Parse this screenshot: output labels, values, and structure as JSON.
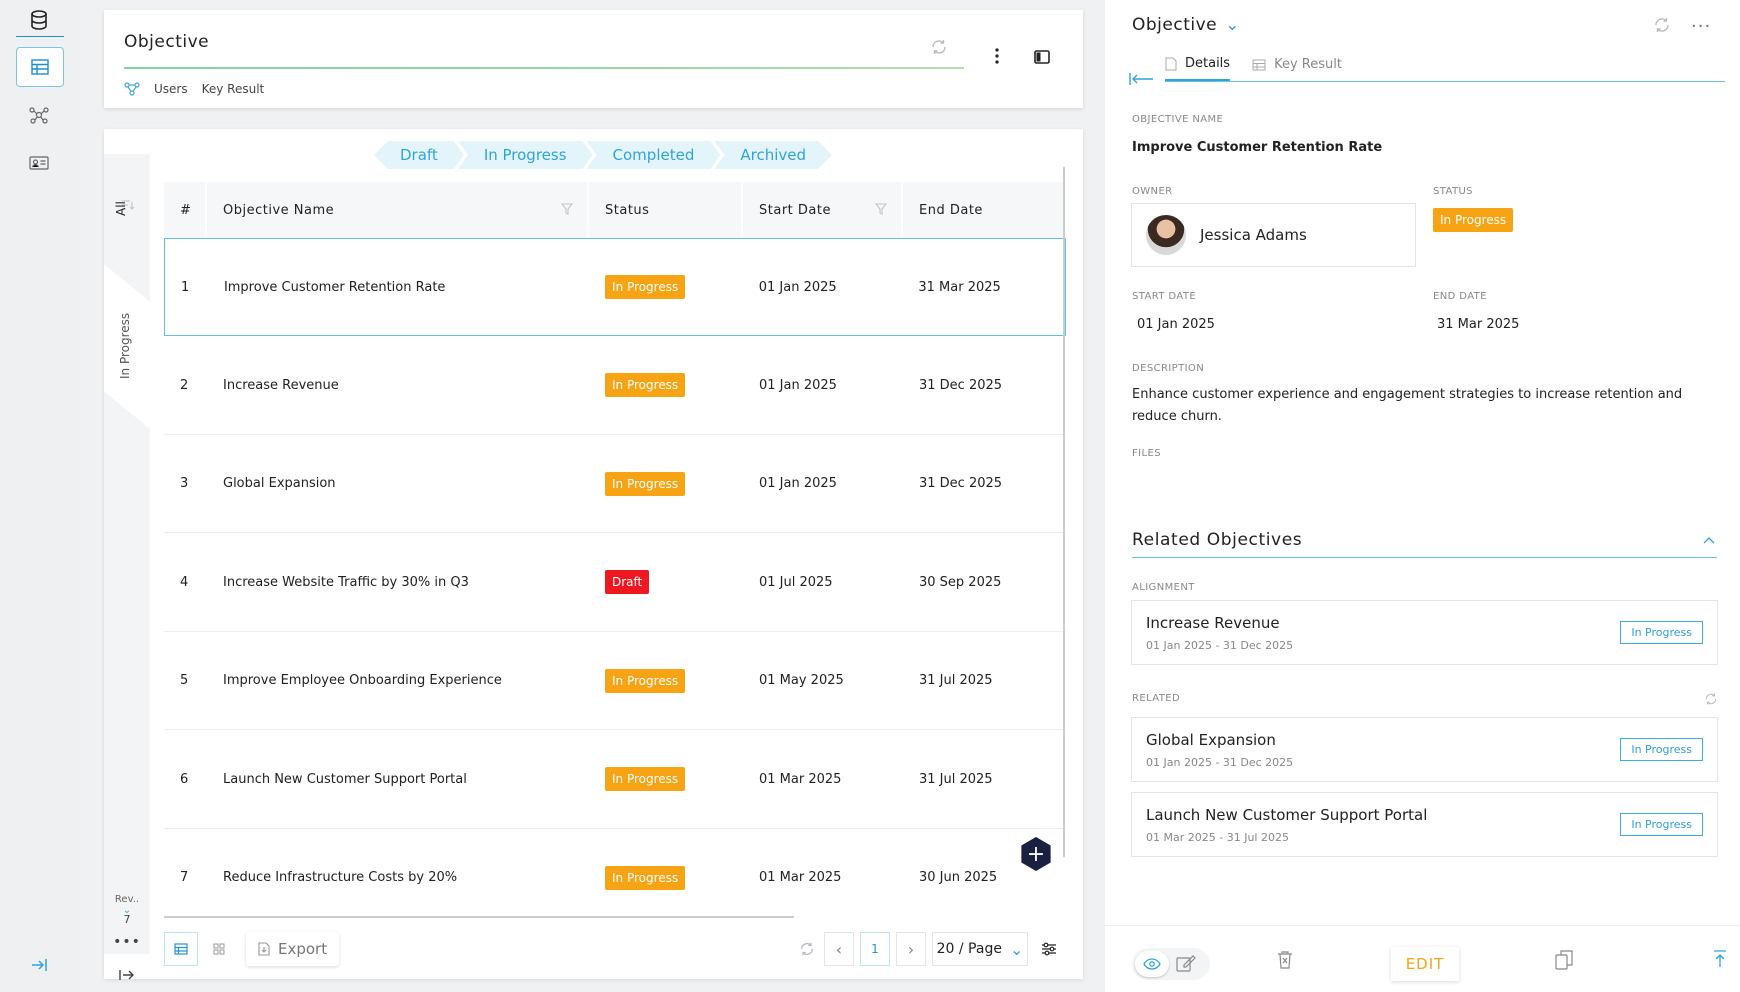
{
  "header": {
    "title": "Objective",
    "links": [
      "Users",
      "Key Result"
    ]
  },
  "status_chips": [
    "Draft",
    "In Progress",
    "Completed",
    "Archived"
  ],
  "side_tabs": {
    "all": "All",
    "in_progress": "In Progress",
    "rev_label": "Rev..",
    "rev_count": "7"
  },
  "table": {
    "columns": [
      "#",
      "Objective Name",
      "Status",
      "Start Date",
      "End Date"
    ],
    "rows": [
      {
        "num": "1",
        "name": "Improve Customer Retention Rate",
        "status": "In Progress",
        "start": "01 Jan 2025",
        "end": "31 Mar 2025"
      },
      {
        "num": "2",
        "name": "Increase Revenue",
        "status": "In Progress",
        "start": "01 Jan 2025",
        "end": "31 Dec 2025"
      },
      {
        "num": "3",
        "name": "Global Expansion",
        "status": "In Progress",
        "start": "01 Jan 2025",
        "end": "31 Dec 2025"
      },
      {
        "num": "4",
        "name": "Increase Website Traffic by 30% in Q3",
        "status": "Draft",
        "start": "01 Jul 2025",
        "end": "30 Sep 2025"
      },
      {
        "num": "5",
        "name": "Improve Employee Onboarding Experience",
        "status": "In Progress",
        "start": "01 May 2025",
        "end": "31 Jul 2025"
      },
      {
        "num": "6",
        "name": "Launch New Customer Support Portal",
        "status": "In Progress",
        "start": "01 Mar 2025",
        "end": "31 Jul 2025"
      },
      {
        "num": "7",
        "name": "Reduce Infrastructure Costs by 20%",
        "status": "In Progress",
        "start": "01 Mar 2025",
        "end": "30 Jun 2025"
      }
    ]
  },
  "footer": {
    "export": "Export",
    "page": "1",
    "per_page": "20 / Page"
  },
  "detail": {
    "title": "Objective",
    "tabs": [
      "Details",
      "Key Result"
    ],
    "objective_name_label": "OBJECTIVE NAME",
    "objective_name": "Improve Customer Retention Rate",
    "owner_label": "OWNER",
    "owner": "Jessica Adams",
    "status_label": "STATUS",
    "status": "In Progress",
    "start_label": "START DATE",
    "start": "01 Jan 2025",
    "end_label": "END DATE",
    "end": "31 Mar 2025",
    "description_label": "DESCRIPTION",
    "description": "Enhance customer experience and engagement strategies to increase retention and reduce churn.",
    "files_label": "FILES",
    "related_title": "Related Objectives",
    "alignment_label": "ALIGNMENT",
    "related_label": "RELATED",
    "alignment": [
      {
        "name": "Increase Revenue",
        "dates": "01 Jan 2025 - 31 Dec 2025",
        "status": "In Progress"
      }
    ],
    "related": [
      {
        "name": "Global Expansion",
        "dates": "01 Jan 2025 - 31 Dec 2025",
        "status": "In Progress"
      },
      {
        "name": "Launch New Customer Support Portal",
        "dates": "01 Mar 2025 - 31 Jul 2025",
        "status": "In Progress"
      }
    ],
    "edit": "EDIT"
  },
  "colors": {
    "accent": "#2fa4db",
    "in_progress": "#f6a314",
    "draft": "#f01820"
  }
}
